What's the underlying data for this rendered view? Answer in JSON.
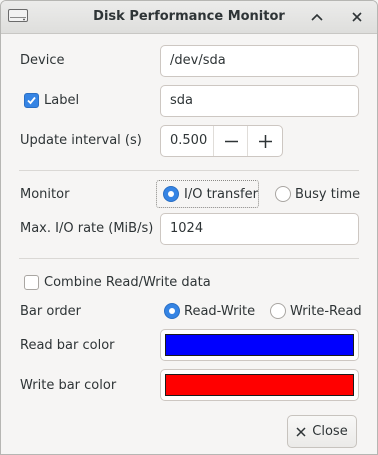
{
  "window": {
    "title": "Disk Performance Monitor"
  },
  "device": {
    "label": "Device",
    "value": "/dev/sda"
  },
  "label_option": {
    "label": "Label",
    "checked": true,
    "value": "sda"
  },
  "update_interval": {
    "label": "Update interval (s)",
    "value": "0.500"
  },
  "monitor": {
    "label": "Monitor",
    "options": [
      "I/O transfer",
      "Busy time"
    ],
    "selected": "I/O transfer"
  },
  "max_io_rate": {
    "label": "Max. I/O rate (MiB/s)",
    "value": "1024"
  },
  "combine": {
    "label": "Combine Read/Write data",
    "checked": false
  },
  "bar_order": {
    "label": "Bar order",
    "options": [
      "Read-Write",
      "Write-Read"
    ],
    "selected": "Read-Write"
  },
  "read_bar_color": {
    "label": "Read bar color",
    "color": "#0000ff"
  },
  "write_bar_color": {
    "label": "Write bar color",
    "color": "#ff0000"
  },
  "close_button": {
    "label": "Close"
  },
  "icons": {
    "app": "disk-icon",
    "minimize": "chevron-up-icon",
    "close_window": "close-icon",
    "decrement": "minus-icon",
    "increment": "plus-icon",
    "close_button": "close-icon"
  },
  "colors": {
    "accent": "#3584e4",
    "window_bg": "#f6f5f4"
  }
}
